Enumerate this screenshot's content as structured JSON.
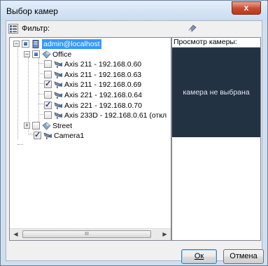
{
  "window": {
    "title": "Выбор камер",
    "close_label": "x"
  },
  "toolbar": {
    "filter_label": "Фильтр:",
    "filter_value": ""
  },
  "tree": [
    {
      "label": "admin@localhost",
      "selected": true,
      "state": "indeterminate",
      "expander": "−",
      "icon": "server-icon"
    },
    {
      "label": "Office",
      "state": "indeterminate",
      "expander": "−",
      "icon": "folder-icon"
    },
    {
      "label": "Axis 211 - 192.168.0.60",
      "state": "unchecked",
      "icon": "camera-icon"
    },
    {
      "label": "Axis 211 - 192.168.0.63",
      "state": "unchecked",
      "icon": "camera-icon"
    },
    {
      "label": "Axis 211 - 192.168.0.69",
      "state": "checked",
      "icon": "camera-icon"
    },
    {
      "label": "Axis 221 - 192.168.0.64",
      "state": "unchecked",
      "icon": "camera-icon"
    },
    {
      "label": "Axis 221 - 192.168.0.70",
      "state": "checked",
      "icon": "camera-icon"
    },
    {
      "label": "Axis 233D - 192.168.0.61 (откл",
      "state": "unchecked",
      "icon": "camera-icon"
    },
    {
      "label": "Street",
      "state": "unchecked",
      "expander": "+",
      "icon": "folder-icon"
    },
    {
      "label": "Camera1",
      "state": "checked",
      "icon": "camera-icon"
    }
  ],
  "scrollbar": {
    "thumb_grip": "III"
  },
  "preview": {
    "header": "Просмотр камеры:",
    "placeholder": "камера не выбрана",
    "bg_color": "#233243"
  },
  "buttons": {
    "ok_label": "Ок",
    "cancel_label": "Отмена"
  }
}
